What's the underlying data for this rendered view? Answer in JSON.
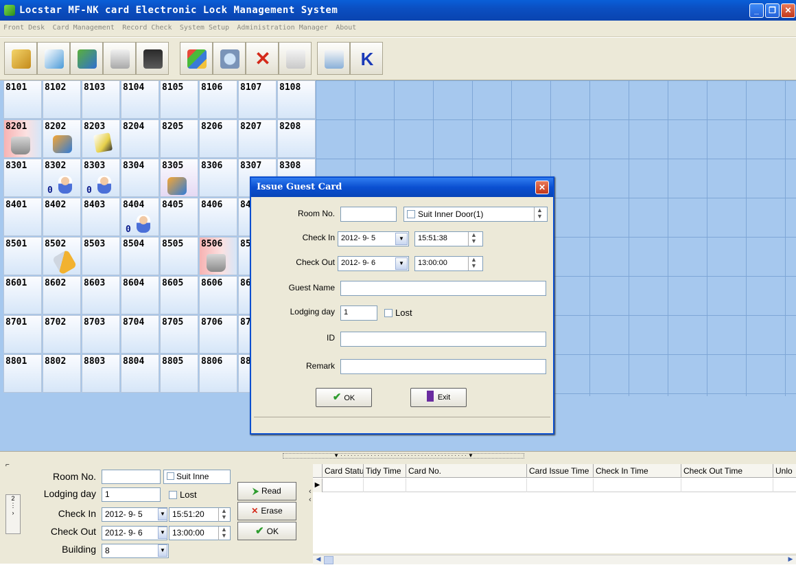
{
  "window": {
    "title": "Locstar MF-NK card Electronic Lock Management System"
  },
  "menu": [
    "Front Desk",
    "Card Management",
    "Record Check",
    "System Setup",
    "Administration Manager",
    "About"
  ],
  "rooms": [
    [
      "8101",
      "8102",
      "8103",
      "8104",
      "8105",
      "8106",
      "8107",
      "8108"
    ],
    [
      "8201",
      "8202",
      "8203",
      "8204",
      "8205",
      "8206",
      "8207",
      "8208"
    ],
    [
      "8301",
      "8302",
      "8303",
      "8304",
      "8305",
      "8306",
      "8307",
      "8308"
    ],
    [
      "8401",
      "8402",
      "8403",
      "8404",
      "8405",
      "8406",
      "84"
    ],
    [
      "8501",
      "8502",
      "8503",
      "8504",
      "8505",
      "8506",
      "85"
    ],
    [
      "8601",
      "8602",
      "8603",
      "8604",
      "8605",
      "8606",
      "86"
    ],
    [
      "8701",
      "8702",
      "8703",
      "8704",
      "8705",
      "8706",
      "87"
    ],
    [
      "8801",
      "8802",
      "8803",
      "8804",
      "8805",
      "8806",
      "88"
    ]
  ],
  "room_badge": "0",
  "dialog": {
    "title": "Issue Guest Card",
    "room_no_label": "Room No.",
    "room_no_value": "",
    "suit_inner_door": "Suit Inner Door(1)",
    "check_in_label": "Check In",
    "check_in_date": "2012- 9- 5",
    "check_in_time": "15:51:38",
    "check_out_label": "Check Out",
    "check_out_date": "2012- 9- 6",
    "check_out_time": "13:00:00",
    "guest_name_label": "Guest Name",
    "lodging_day_label": "Lodging day",
    "lodging_day_value": "1",
    "lost_label": "Lost",
    "id_label": "ID",
    "remark_label": "Remark",
    "ok_label": "OK",
    "exit_label": "Exit"
  },
  "bottom": {
    "room_no_label": "Room No.",
    "suit_inner": "Suit Inne",
    "lodging_day_label": "Lodging day",
    "lodging_day_value": "1",
    "lost_label": "Lost",
    "check_in_label": "Check In",
    "check_in_date": "2012- 9- 5",
    "check_in_time": "15:51:20",
    "check_out_label": "Check Out",
    "check_out_date": "2012- 9- 6",
    "check_out_time": "13:00:00",
    "building_label": "Building",
    "building_value": "8",
    "read_label": "Read",
    "erase_label": "Erase",
    "ok_label": "OK",
    "side_tab": "2"
  },
  "table": {
    "columns": [
      "Card Statu",
      "Tidy Time",
      "Card No.",
      "Card Issue Time",
      "Check In Time",
      "Check Out Time",
      "Unlo"
    ]
  }
}
